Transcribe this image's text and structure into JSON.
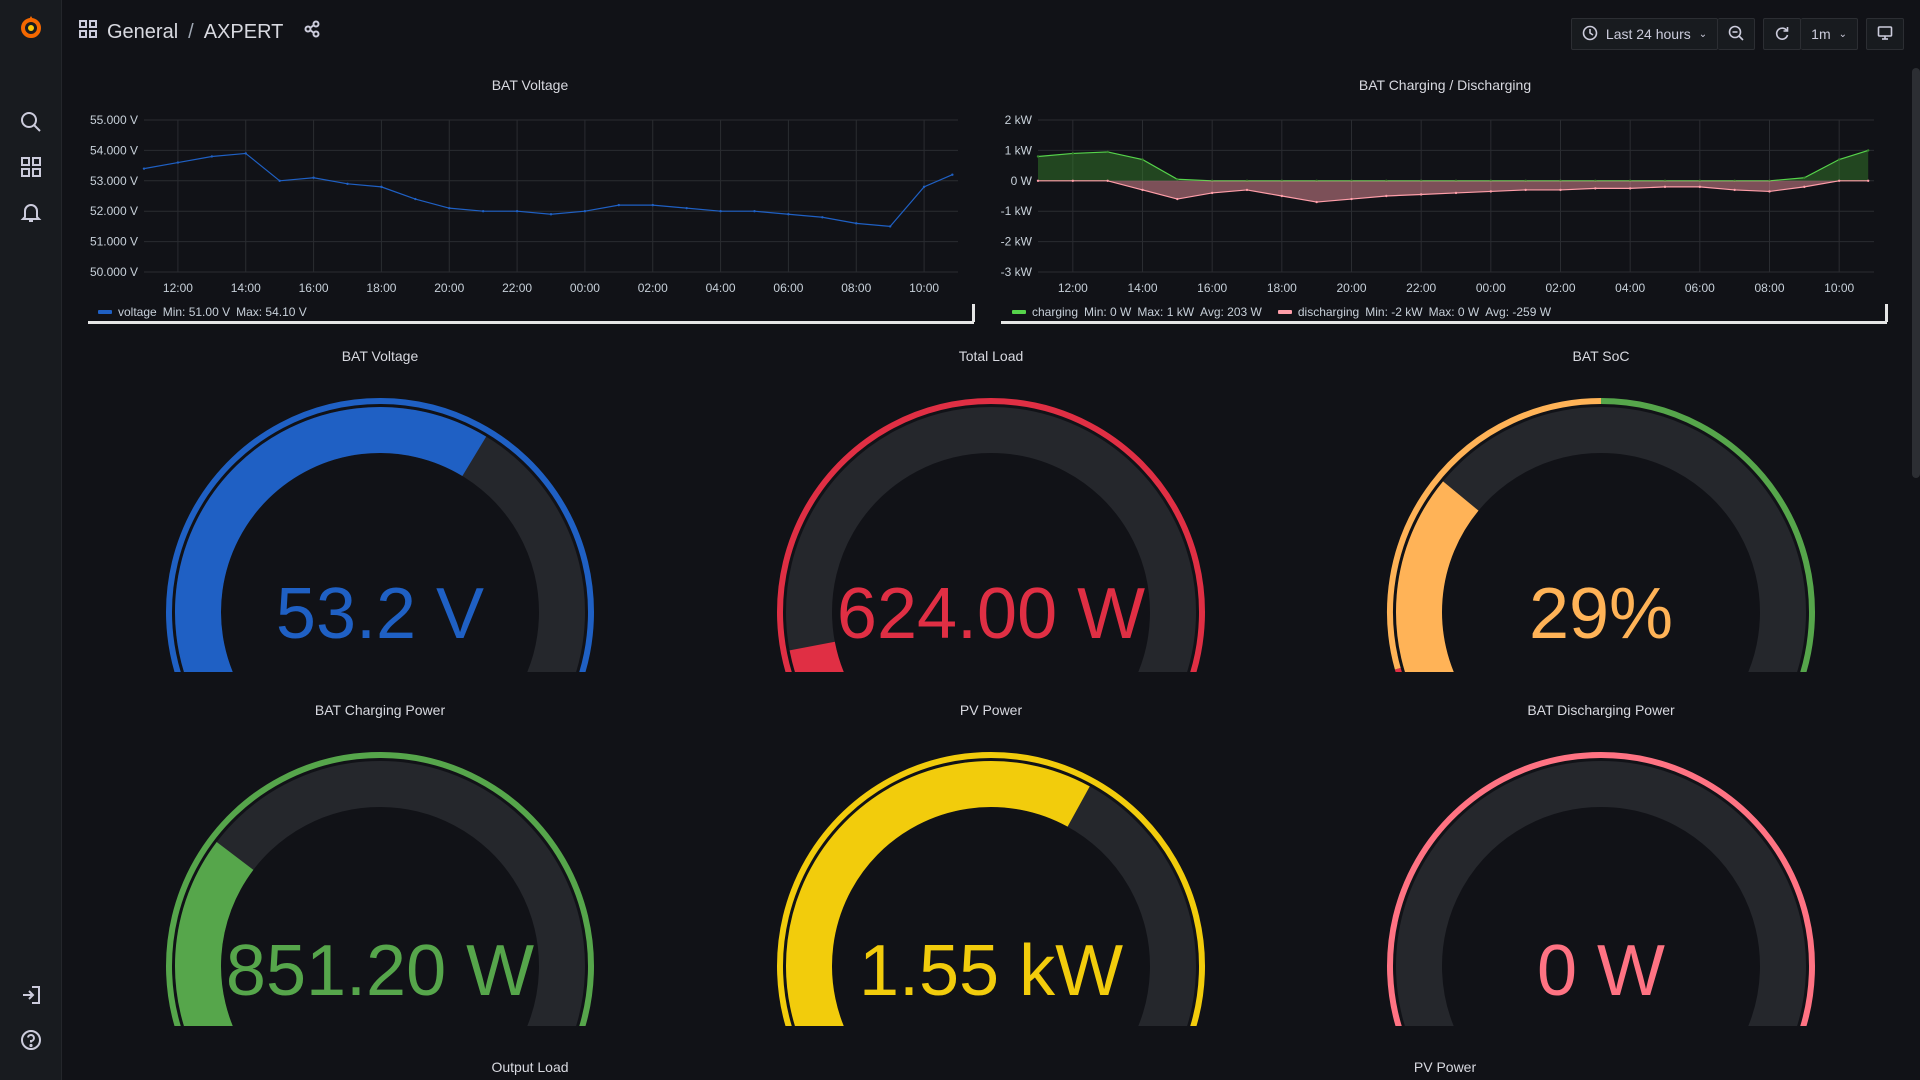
{
  "breadcrumb": {
    "folder": "General",
    "separator": "/",
    "dashboard": "AXPERT"
  },
  "toolbar": {
    "time_range": "Last 24 hours",
    "refresh_interval": "1m"
  },
  "icons": {
    "logo": "grafana-logo-icon",
    "search": "search-icon",
    "dashboards": "dashboards-icon",
    "alerting": "bell-icon",
    "signin": "sign-in-icon",
    "help": "help-icon",
    "share": "share-icon",
    "clock": "clock-icon",
    "zoom_out": "zoom-out-icon",
    "refresh": "refresh-icon",
    "tv": "tv-mode-icon"
  },
  "colors": {
    "blue": "#1f60c4",
    "red": "#e02f44",
    "orange": "#ffb357",
    "green": "#56a64b",
    "yellow": "#f2cc0c",
    "pink": "#ff7383",
    "track": "#25272c"
  },
  "chart_data": [
    {
      "type": "line",
      "title": "BAT Voltage",
      "x_ticks": [
        "12:00",
        "14:00",
        "16:00",
        "18:00",
        "20:00",
        "22:00",
        "00:00",
        "02:00",
        "04:00",
        "06:00",
        "08:00",
        "10:00"
      ],
      "y_ticks": [
        "55.000 V",
        "54.000 V",
        "53.000 V",
        "52.000 V",
        "51.000 V",
        "50.000 V"
      ],
      "ylim": [
        50,
        55
      ],
      "grid": true,
      "series": [
        {
          "name": "voltage",
          "color": "#1f60c4",
          "x": [
            "11:00",
            "12:00",
            "13:00",
            "14:00",
            "15:00",
            "16:00",
            "17:00",
            "18:00",
            "19:00",
            "20:00",
            "21:00",
            "22:00",
            "23:00",
            "00:00",
            "01:00",
            "02:00",
            "03:00",
            "04:00",
            "05:00",
            "06:00",
            "07:00",
            "08:00",
            "09:00",
            "10:00",
            "10:50"
          ],
          "values": [
            53.4,
            53.6,
            53.8,
            53.9,
            53.0,
            53.1,
            52.9,
            52.8,
            52.4,
            52.1,
            52.0,
            52.0,
            51.9,
            52.0,
            52.2,
            52.2,
            52.1,
            52.0,
            52.0,
            51.9,
            51.8,
            51.6,
            51.5,
            52.8,
            53.2
          ],
          "legend": {
            "min": "Min: 51.00 V",
            "max": "Max: 54.10 V"
          }
        }
      ],
      "legend_placement": "bottom"
    },
    {
      "type": "area",
      "title": "BAT Charging / Discharging",
      "x_ticks": [
        "12:00",
        "14:00",
        "16:00",
        "18:00",
        "20:00",
        "22:00",
        "00:00",
        "02:00",
        "04:00",
        "06:00",
        "08:00",
        "10:00"
      ],
      "y_ticks": [
        "2 kW",
        "1 kW",
        "0 W",
        "-1 kW",
        "-2 kW",
        "-3 kW"
      ],
      "ylim": [
        -3000,
        2000
      ],
      "grid": true,
      "series": [
        {
          "name": "charging",
          "color": "#37872d",
          "x": [
            "11:00",
            "12:00",
            "13:00",
            "14:00",
            "15:00",
            "16:00",
            "17:00",
            "18:00",
            "19:00",
            "20:00",
            "21:00",
            "22:00",
            "23:00",
            "00:00",
            "01:00",
            "02:00",
            "03:00",
            "04:00",
            "05:00",
            "06:00",
            "07:00",
            "08:00",
            "09:00",
            "10:00",
            "10:50"
          ],
          "values": [
            800,
            900,
            950,
            700,
            50,
            0,
            0,
            0,
            0,
            0,
            0,
            0,
            0,
            0,
            0,
            0,
            0,
            0,
            0,
            0,
            0,
            0,
            100,
            700,
            1000
          ],
          "legend": {
            "min": "Min: 0 W",
            "max": "Max: 1 kW",
            "avg": "Avg: 203 W"
          }
        },
        {
          "name": "discharging",
          "color": "#ff9ea9",
          "x": [
            "11:00",
            "12:00",
            "13:00",
            "14:00",
            "15:00",
            "16:00",
            "17:00",
            "18:00",
            "19:00",
            "20:00",
            "21:00",
            "22:00",
            "23:00",
            "00:00",
            "01:00",
            "02:00",
            "03:00",
            "04:00",
            "05:00",
            "06:00",
            "07:00",
            "08:00",
            "09:00",
            "10:00",
            "10:50"
          ],
          "values": [
            0,
            0,
            0,
            -300,
            -600,
            -400,
            -300,
            -500,
            -700,
            -600,
            -500,
            -450,
            -400,
            -350,
            -300,
            -300,
            -250,
            -250,
            -200,
            -200,
            -300,
            -350,
            -200,
            0,
            0
          ],
          "legend": {
            "min": "Min: -2 kW",
            "max": "Max: 0 W",
            "avg": "Avg: -259 W"
          }
        }
      ],
      "legend_placement": "bottom"
    }
  ],
  "gauges": [
    {
      "title": "BAT Voltage",
      "value": "53.2 V",
      "fraction": 0.63,
      "color": "#1f60c4",
      "threshold_colors": [
        "#1f60c4"
      ]
    },
    {
      "title": "Total Load",
      "value": "624.00 W",
      "fraction": 0.08,
      "color": "#e02f44",
      "threshold_colors": [
        "#e02f44"
      ]
    },
    {
      "title": "BAT SoC",
      "value": "29%",
      "fraction": 0.29,
      "color": "#ffb357",
      "threshold_colors": [
        "#e02f44",
        "#ffb357",
        "#56a64b"
      ]
    },
    {
      "title": "BAT Charging Power",
      "value": "851.20 W",
      "fraction": 0.28,
      "color": "#56a64b",
      "threshold_colors": [
        "#56a64b"
      ]
    },
    {
      "title": "PV Power",
      "value": "1.55 kW",
      "fraction": 0.62,
      "color": "#f2cc0c",
      "threshold_colors": [
        "#f2cc0c"
      ]
    },
    {
      "title": "BAT Discharging Power",
      "value": "0 W",
      "fraction": 0.0,
      "color": "#ff7383",
      "threshold_colors": [
        "#ff7383"
      ]
    }
  ],
  "bottom_panels": [
    {
      "title": "Output Load"
    },
    {
      "title": "PV Power"
    }
  ]
}
